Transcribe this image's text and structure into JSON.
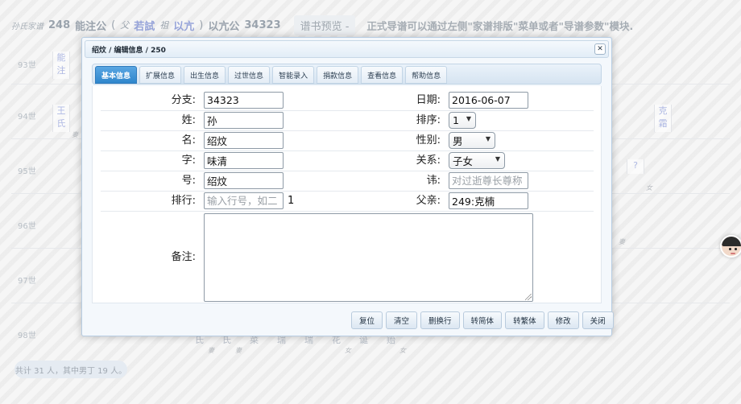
{
  "background": {
    "header": {
      "family_label": "孙氏家谱",
      "person_number": "248",
      "person_name": "能注公",
      "paren_open": "(",
      "father_prefix": "父",
      "father_name": "若試",
      "ancestor_prefix": "祖",
      "ancestor_name": "以亢",
      "paren_close": ")",
      "lineage_name": "以亢公",
      "lineage_number": "34323",
      "preview_label": "谱书预览 -",
      "notice": "正式导谱可以通过左侧\"家谱排版\"菜单或者\"导谱参数\"模块."
    },
    "generations": [
      "93世",
      "94世",
      "95世",
      "96世",
      "97世",
      "98世"
    ],
    "visible_names": {
      "n93": "能注",
      "n94": "王氏",
      "n94_tag": "妻",
      "right_name": "克霜",
      "right_q": "?",
      "right_q_tag": "女",
      "right_tag": "妻"
    },
    "bottom_names": [
      "氏",
      "氏",
      "菜",
      "瑞",
      "瑞",
      "花",
      "诞",
      "贻"
    ],
    "bottom_tags": [
      "妻",
      "妻",
      "女",
      "女"
    ],
    "footer": "共计 31 人，其中男丁 19 人。"
  },
  "dialog": {
    "title": "绍炆 / 编辑信息 / 250",
    "close_glyph": "✕",
    "tabs": [
      {
        "label": "基本信息",
        "active": true
      },
      {
        "label": "扩展信息",
        "active": false
      },
      {
        "label": "出生信息",
        "active": false
      },
      {
        "label": "过世信息",
        "active": false
      },
      {
        "label": "智能录入",
        "active": false
      },
      {
        "label": "捐款信息",
        "active": false
      },
      {
        "label": "查看信息",
        "active": false
      },
      {
        "label": "帮助信息",
        "active": false
      }
    ],
    "form": {
      "branch": {
        "label": "分支:",
        "value": "34323"
      },
      "surname": {
        "label": "姓:",
        "value": "孙"
      },
      "given_name": {
        "label": "名:",
        "value": "绍炆"
      },
      "courtesy": {
        "label": "字:",
        "value": "味清"
      },
      "alias": {
        "label": "号:",
        "value": "绍炆"
      },
      "rank": {
        "label": "排行:",
        "placeholder": "输入行号，如二",
        "value": "1"
      },
      "date": {
        "label": "日期:",
        "value": "2016-06-07"
      },
      "order": {
        "label": "排序:",
        "value": "1"
      },
      "gender": {
        "label": "性别:",
        "value": "男"
      },
      "relation": {
        "label": "关系:",
        "value": "子女"
      },
      "taboo": {
        "label": "讳:",
        "placeholder": "对过逝尊长尊称"
      },
      "father": {
        "label": "父亲:",
        "value": "249:克楠"
      },
      "remark": {
        "label": "备注:",
        "value": ""
      }
    },
    "buttons": {
      "reset": "复位",
      "clear": "清空",
      "remove_newline": "删换行",
      "to_simplified": "转简体",
      "to_traditional": "转繁体",
      "modify": "修改",
      "close": "关闭"
    }
  }
}
